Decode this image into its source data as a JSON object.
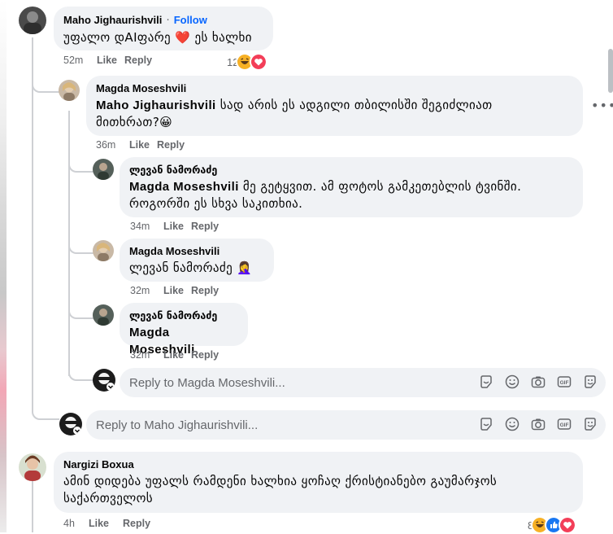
{
  "comments": [
    {
      "author": "Maho Jighaurishvili",
      "separator": "·",
      "follow": "Follow",
      "text": "უფალო დAIფარე ❤️ ეს ხალხი",
      "time": "52m",
      "like": "Like",
      "reply": "Reply",
      "reaction_count": "12"
    },
    {
      "author": "Magda Moseshvili",
      "mention": "Maho Jighaurishvili",
      "text_line1": " სად არის ეს ადგილი თბილისში შეგიძლიათ",
      "text_line2": "მითხრათ?😀",
      "time": "36m",
      "like": "Like",
      "reply": "Reply",
      "more": "•••"
    },
    {
      "author": "ლევან ნამორაძე",
      "mention": "Magda Moseshvili",
      "text_line1": " მე გეტყვით. ამ ფოტოს გამკეთებლის ტვინში.",
      "text_line2": "როგორში ეს სხვა საკითხია.",
      "time": "34m",
      "like": "Like",
      "reply": "Reply"
    },
    {
      "author": "Magda Moseshvili",
      "text": "ლევან ნამორაძე 🤦‍♀️",
      "time": "32m",
      "like": "Like",
      "reply": "Reply"
    },
    {
      "author": "ლევან ნამორაძე",
      "mention": "Magda Moseshvili",
      "time": "32m",
      "like": "Like",
      "reply": "Reply"
    },
    {
      "author": "Nargizi Boxua",
      "text_line1": "ამინ დიდება უფალს რამდენი ხალხია ყოჩაღ ქრისტიანებო გაუმარჯოს",
      "text_line2": "საქართველოს",
      "time": "4h",
      "like": "Like",
      "reply": "Reply",
      "reaction_count": "8"
    }
  ],
  "reply_boxes": [
    {
      "placeholder": "Reply to Magda Moseshvili..."
    },
    {
      "placeholder": "Reply to Maho Jighaurishvili..."
    }
  ],
  "icons": [
    "sticker-icon",
    "emoji-icon",
    "camera-icon",
    "gif-icon",
    "avatar-sticker-icon"
  ],
  "colors": {
    "bubble": "#f0f2f5",
    "link_blue": "#0866ff",
    "meta_gray": "#65676b",
    "heart_red": "#f33e58",
    "like_blue": "#1877f2",
    "haha_yellow": "#f7b125"
  }
}
